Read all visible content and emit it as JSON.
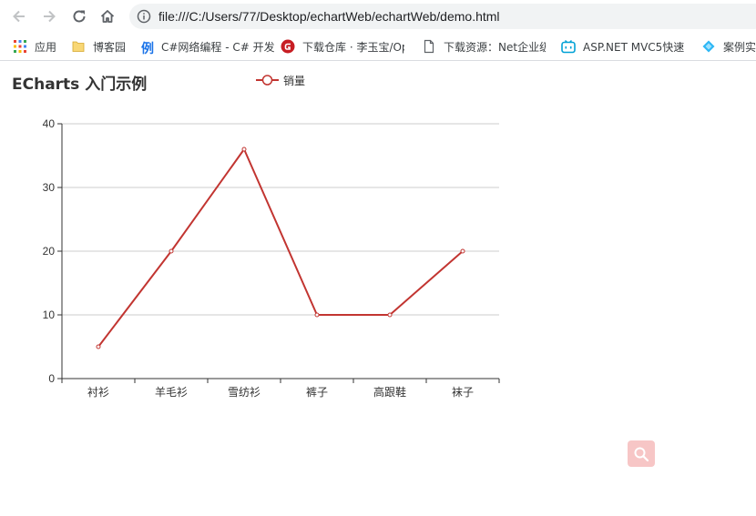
{
  "browser": {
    "url": "file:///C:/Users/77/Desktop/echartWeb/echartWeb/demo.html",
    "bookmarks": [
      {
        "label": "应用",
        "icon": "apps-grid-icon"
      },
      {
        "label": "博客园",
        "icon": "folder-icon"
      },
      {
        "label": "C#网络编程 - C# 开发",
        "icon": "li-logo-icon"
      },
      {
        "label": "下载仓库 · 李玉宝/Op",
        "icon": "gitee-icon"
      },
      {
        "label": "下载资源：Net企业级",
        "icon": "page-icon"
      },
      {
        "label": "ASP.NET MVC5快速",
        "icon": "bilibili-icon"
      },
      {
        "label": "案例实",
        "icon": "diamond-icon"
      }
    ]
  },
  "page": {
    "title": "ECharts 入门示例",
    "legend_label": "销量"
  },
  "colors": {
    "series": "#c23531",
    "axis": "#333333",
    "grid": "#cccccc",
    "fab": "#f7c6c6"
  },
  "chart_data": {
    "type": "line",
    "title": "ECharts 入门示例",
    "categories": [
      "衬衫",
      "羊毛衫",
      "雪纺衫",
      "裤子",
      "高跟鞋",
      "袜子"
    ],
    "series": [
      {
        "name": "销量",
        "values": [
          5,
          20,
          36,
          10,
          10,
          20
        ]
      }
    ],
    "ylim": [
      0,
      40
    ],
    "yticks": [
      0,
      10,
      20,
      30,
      40
    ],
    "grid": true,
    "legend_position": "top"
  }
}
